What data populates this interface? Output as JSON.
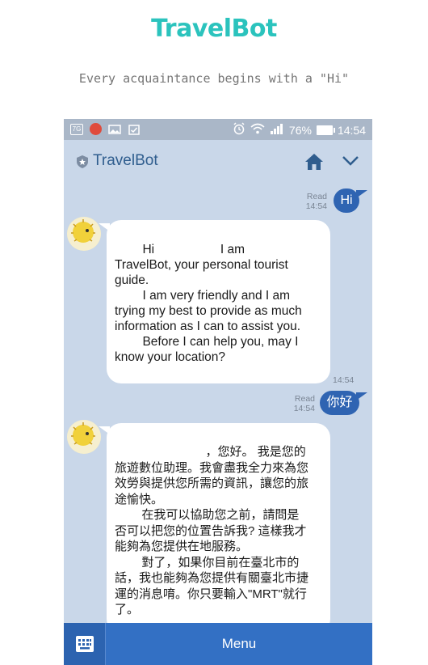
{
  "page": {
    "title": "TravelBot",
    "subtitle": "Every acquaintance begins with a \"Hi\""
  },
  "statusbar": {
    "left_icons": [
      "notification-box-icon",
      "app-red-icon",
      "image-icon",
      "clipboard-icon"
    ],
    "left_box_text": "7G",
    "battery": "76%",
    "time": "14:54"
  },
  "header": {
    "title": "TravelBot",
    "icons": [
      "shield-icon",
      "home-icon",
      "chevron-down-icon"
    ]
  },
  "messages": [
    {
      "from": "user",
      "text": "Hi",
      "status": "Read",
      "time": "14:54"
    },
    {
      "from": "bot",
      "text": "        Hi                   I am\nTravelBot, your personal tourist\nguide.\n        I am very friendly and I am\ntrying my best to provide as much\ninformation as I can to assist you.\n        Before I can help you, may I\nknow your location?",
      "time": "14:54"
    },
    {
      "from": "user",
      "text": "你好",
      "status": "Read",
      "time": "14:54"
    },
    {
      "from": "bot",
      "text": "                           ，您好。 我是您的\n旅遊數位助理。我會盡我全力來為您\n效勞與提供您所需的資訊，讓您的旅\n途愉快。\n        在我可以協助您之前，請問是\n否可以把您的位置告訴我? 這樣我才\n能夠為您提供在地服務。\n        對了，如果你目前在臺北市的\n話，我也能夠為您提供有關臺北市捷\n運的消息唷。你只要輸入\"MRT\"就行\n了。"
    }
  ],
  "bottom_bar": {
    "keyboard_icon": "keyboard-icon",
    "menu_label": "Menu"
  },
  "colors": {
    "title": "#2bc3bd",
    "chat_bg": "#c9d7e9",
    "header_text": "#2f5d8e",
    "user_bubble": "#2f64b2",
    "bottom_bar": "#3370c4"
  }
}
